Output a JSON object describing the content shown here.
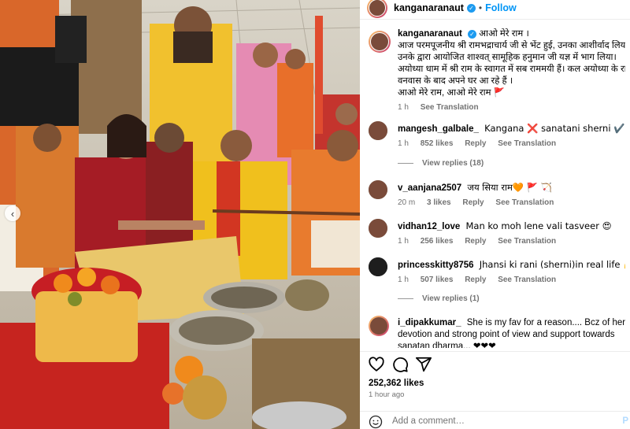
{
  "post": {
    "username": "kanganaranaut",
    "follow_label": "Follow",
    "separator": "•",
    "caption_lines": [
      "आओ मेरे राम ।",
      "आज परमपूजनीय श्री रामभद्राचार्य जी से भेंट हुई, उनका आशीर्वाद लिया।",
      "उनके द्वारा आयोजित शाश्वत् सामूहिक हनुमान जी यज्ञ में भाग लिया।",
      "अयोध्या धाम में श्री राम के स्वागत में सब राममयी हैं। कल अयोध्या के राजा लम्बे",
      "वनवास के बाद अपने घर आ रहे हैं ।",
      "आओ मेरे राम, आओ मेरे राम 🚩"
    ],
    "caption_time": "1 h",
    "see_translation": "See Translation",
    "accent_color": "#0095f6"
  },
  "comments": [
    {
      "user": "mangesh_galbale_",
      "text": "Kangana ❌ sanatani sherni ✔️",
      "time": "1 h",
      "likes": "852 likes",
      "reply": "Reply",
      "translate": "See Translation",
      "view_replies": "View replies (18)"
    },
    {
      "user": "v_aanjana2507",
      "text": "जय सिया राम🧡 🚩 🏹",
      "time": "20 m",
      "likes": "3 likes",
      "reply": "Reply",
      "translate": "See Translation"
    },
    {
      "user": "vidhan12_love",
      "text": "Man ko moh lene vali tasveer 😍",
      "time": "1 h",
      "likes": "256 likes",
      "reply": "Reply",
      "translate": "See Translation"
    },
    {
      "user": "princesskitty8756",
      "text": "Jhansi ki rani (sherni)in real life 💪",
      "time": "1 h",
      "likes": "507 likes",
      "reply": "Reply",
      "translate": "See Translation",
      "view_replies": "View replies (1)"
    },
    {
      "user": "i_dipakkumar_",
      "text_lines": [
        "She is my fav for a reason.... Bcz of her",
        "devotion and strong point of view and support towards",
        "sanatan dharma... ❤❤❤"
      ]
    }
  ],
  "footer": {
    "likes": "252,362 likes",
    "time": "1 hour ago",
    "add_comment_placeholder": "Add a comment…",
    "post_label": "P"
  },
  "icons": [
    "heart-icon",
    "comment-icon",
    "share-icon",
    "emoji-icon",
    "chevron-left-icon",
    "verified-badge-icon"
  ]
}
